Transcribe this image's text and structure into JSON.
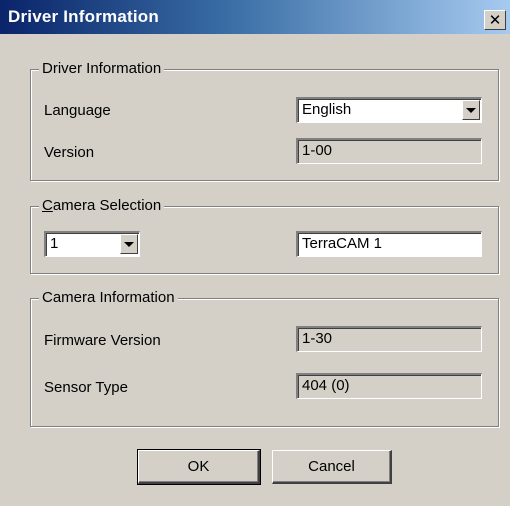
{
  "window": {
    "title": "Driver Information",
    "close_symbol": "✕"
  },
  "driver_group": {
    "legend": "Driver Information",
    "language_label": "Language",
    "language_value": "English",
    "version_label": "Version",
    "version_value": "1-00"
  },
  "camera_selection": {
    "legend_underlined": "C",
    "legend_rest": "amera Selection",
    "camera_number": "1",
    "camera_name": "TerraCAM 1"
  },
  "camera_info": {
    "legend": "Camera Information",
    "firmware_label": "Firmware Version",
    "firmware_value": "1-30",
    "sensor_label": "Sensor Type",
    "sensor_value": "404 (0)"
  },
  "buttons": {
    "ok": "OK",
    "cancel": "Cancel"
  },
  "icons": {
    "close": "close-icon",
    "dropdown": "chevron-down-icon"
  }
}
